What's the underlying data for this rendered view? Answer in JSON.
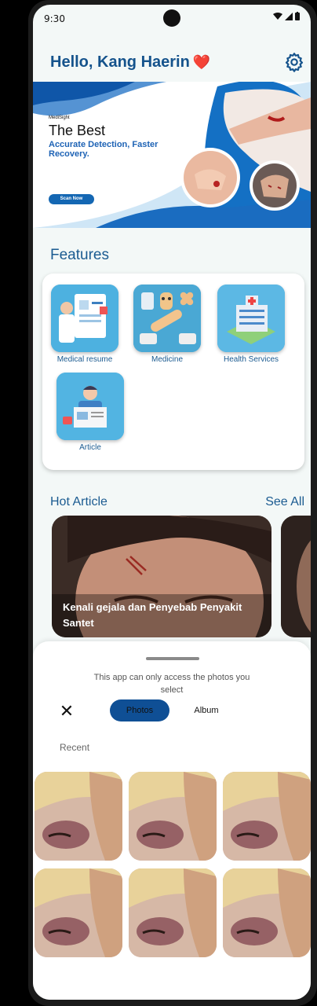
{
  "status": {
    "time": "9:30"
  },
  "header": {
    "greeting": "Hello, Kang Haerin",
    "emoji": "❤️"
  },
  "banner": {
    "brand": "MediSight",
    "title": "The Best",
    "subtitle": "Accurate Detection, Faster Recovery.",
    "button": "Scan Now"
  },
  "features": {
    "title": "Features",
    "items": [
      {
        "label": "Medical resume"
      },
      {
        "label": "Medicine"
      },
      {
        "label": "Health Services"
      },
      {
        "label": "Article"
      }
    ]
  },
  "hot_article": {
    "title": "Hot Article",
    "see_all": "See All",
    "cards": [
      {
        "caption": "Kenali gejala dan Penyebab Penyakit Santet"
      }
    ]
  },
  "picker": {
    "notice": "This app can only access the photos you select",
    "close_icon": "close-icon",
    "tabs": {
      "photos": "Photos",
      "album": "Album"
    },
    "recent_label": "Recent",
    "photo_count": 6
  },
  "colors": {
    "primary": "#15538c",
    "accent": "#0f4f95",
    "heart": "#e53935"
  }
}
